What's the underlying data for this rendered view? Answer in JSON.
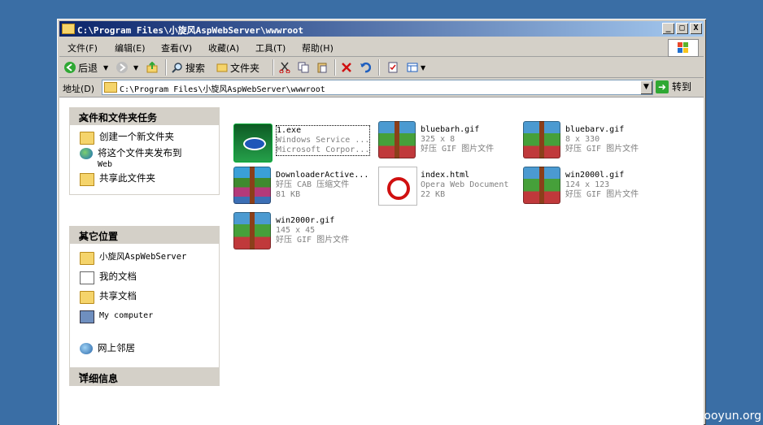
{
  "window": {
    "title": "C:\\Program Files\\小旋风AspWebServer\\wwwroot",
    "min_label": "_",
    "max_label": "□",
    "close_label": "X"
  },
  "menu": [
    "文件(F)",
    "编辑(E)",
    "查看(V)",
    "收藏(A)",
    "工具(T)",
    "帮助(H)"
  ],
  "toolbar": {
    "back": "后退",
    "search": "搜索",
    "folders": "文件夹"
  },
  "address": {
    "label": "地址(D)",
    "path": "C:\\Program Files\\小旋风AspWebServer\\wwwroot",
    "go": "转到"
  },
  "tasks_panel": {
    "title": "文件和文件夹任务",
    "items": [
      "创建一个新文件夹",
      "将这个文件夹发布到",
      "Web",
      "共享此文件夹"
    ]
  },
  "places_panel": {
    "title": "其它位置",
    "items": [
      "小旋风AspWebServer",
      "我的文档",
      "共享文档",
      "My computer",
      "网上邻居"
    ]
  },
  "details_panel": {
    "title": "详细信息"
  },
  "files": [
    {
      "name": "1.exe",
      "line2": "Windows Service ...",
      "line3": "Microsoft Corpor..."
    },
    {
      "name": "bluebarh.gif",
      "line2": "325 x 8",
      "line3": "好压 GIF 图片文件"
    },
    {
      "name": "bluebarv.gif",
      "line2": "8 x 330",
      "line3": "好压 GIF 图片文件"
    },
    {
      "name": "DownloaderActive...",
      "line2": "好压 CAB 压缩文件",
      "line3": "81 KB"
    },
    {
      "name": "index.html",
      "line2": "Opera Web Document",
      "line3": "22 KB"
    },
    {
      "name": "win2000l.gif",
      "line2": "124 x 123",
      "line3": "好压 GIF 图片文件"
    },
    {
      "name": "win2000r.gif",
      "line2": "145 x 45",
      "line3": "好压 GIF 图片文件"
    }
  ],
  "watermark": "www.wooyun.org"
}
